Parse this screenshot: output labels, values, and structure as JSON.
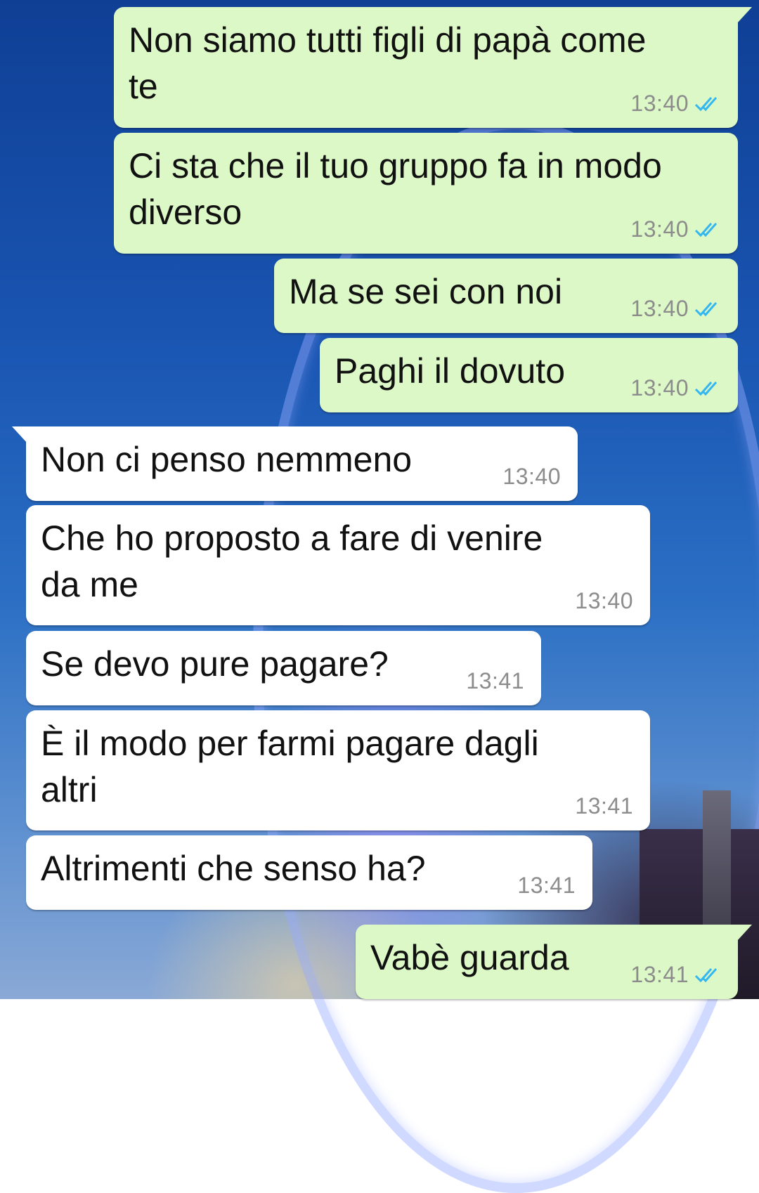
{
  "colors": {
    "outgoing_bubble": "#dcf8c6",
    "incoming_bubble": "#ffffff",
    "read_ticks": "#34b7f1",
    "timestamp": "#8c8c8c"
  },
  "messages": [
    {
      "direction": "out",
      "text": "Non siamo tutti figli di papà come\nte",
      "time": "13:40",
      "status": "read-ticks"
    },
    {
      "direction": "out",
      "text": "Ci sta che il tuo gruppo fa in modo\ndiverso",
      "time": "13:40",
      "status": "read-ticks"
    },
    {
      "direction": "out",
      "text": "Ma se sei con noi",
      "time": "13:40",
      "status": "read-ticks"
    },
    {
      "direction": "out",
      "text": "Paghi il dovuto",
      "time": "13:40",
      "status": "read-ticks"
    },
    {
      "direction": "in",
      "text": "Non ci penso nemmeno",
      "time": "13:40"
    },
    {
      "direction": "in",
      "text": "Che ho proposto a fare di venire\nda me",
      "time": "13:40"
    },
    {
      "direction": "in",
      "text": "Se devo pure pagare?",
      "time": "13:41"
    },
    {
      "direction": "in",
      "text": "È il modo per farmi pagare dagli\naltri",
      "time": "13:41"
    },
    {
      "direction": "in",
      "text": "Altrimenti che senso ha?",
      "time": "13:41"
    },
    {
      "direction": "out",
      "text": "Vabè guarda",
      "time": "13:41",
      "status": "read-ticks"
    }
  ]
}
